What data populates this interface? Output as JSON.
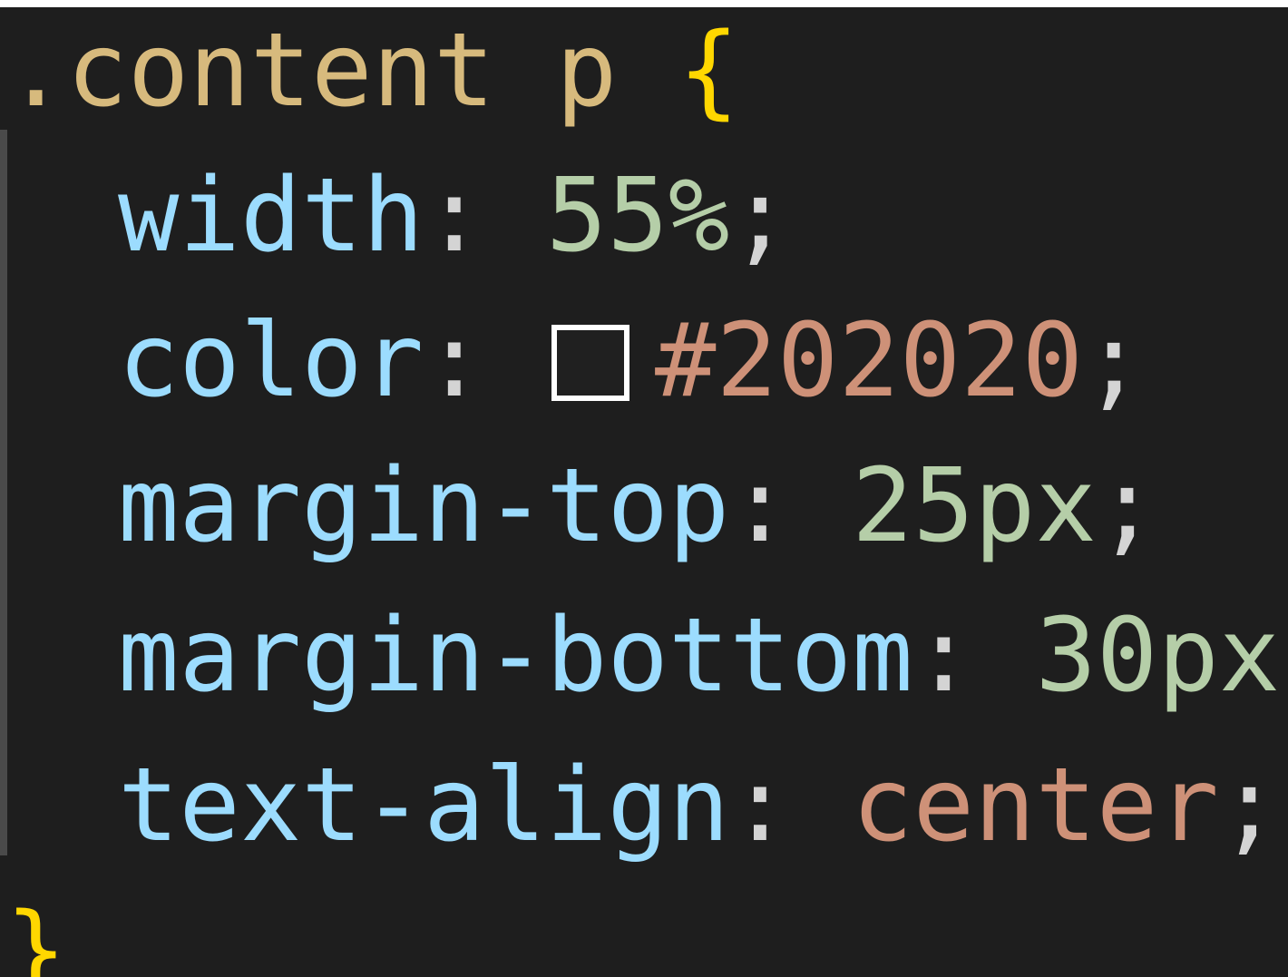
{
  "colors": {
    "background": "#1e1e1e",
    "selector": "#d7ba7d",
    "brace": "#ffd700",
    "property": "#9cdcfe",
    "number": "#b5cea8",
    "string": "#ce9178",
    "punctuation": "#d4d4d4"
  },
  "code": {
    "selector": ".content p",
    "open_brace": "{",
    "close_brace": "}",
    "declarations": [
      {
        "property": "width",
        "value": "55%"
      },
      {
        "property": "color",
        "value": "#202020",
        "swatch_color": "#202020"
      },
      {
        "property": "margin-top",
        "value": "25px"
      },
      {
        "property": "margin-bottom",
        "value": "30px"
      },
      {
        "property": "text-align",
        "value": "center"
      }
    ],
    "colon": ":",
    "semicolon": ";"
  }
}
